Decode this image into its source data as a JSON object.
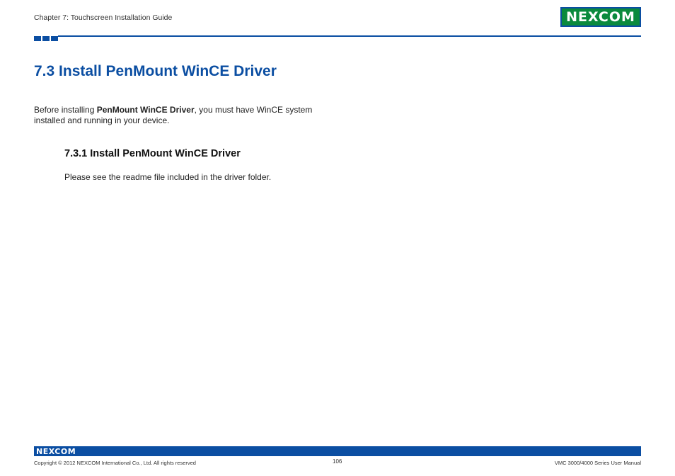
{
  "header": {
    "chapter": "Chapter 7: Touchscreen Installation Guide",
    "logo": "NEXCOM"
  },
  "section": {
    "title": "7.3  Install PenMount WinCE Driver",
    "intro_before": "Before installing ",
    "intro_bold": "PenMount WinCE Driver",
    "intro_after": ", you must have WinCE system installed and running in your device."
  },
  "subsection": {
    "title": "7.3.1  Install PenMount WinCE Driver",
    "text": "Please see the readme file included in the driver folder."
  },
  "footer": {
    "logo": "NEXCOM",
    "copyright": "Copyright © 2012 NEXCOM International Co., Ltd. All rights reserved",
    "page": "106",
    "manual": "VMC 3000/4000 Series User Manual"
  }
}
